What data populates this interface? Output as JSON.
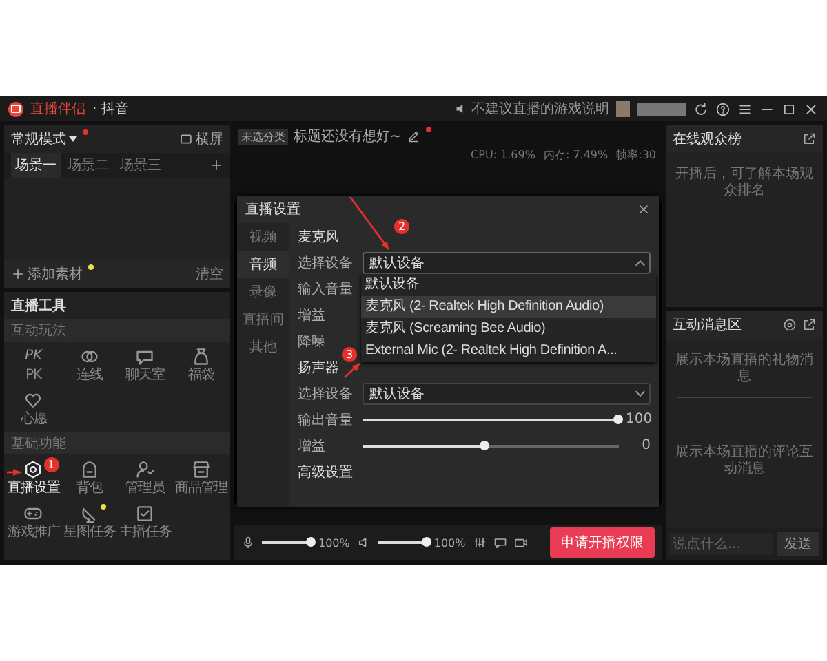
{
  "window": {
    "app_name": "直播伴侣",
    "platform": "· 抖音",
    "notice": "不建议直播的游戏说明"
  },
  "left_panel": {
    "mode": {
      "label": "常规模式",
      "new": true
    },
    "orientation": "横屏",
    "scenes": [
      {
        "label": "场景一",
        "selected": true
      },
      {
        "label": "场景二",
        "selected": false
      },
      {
        "label": "场景三",
        "selected": false
      }
    ],
    "add_material": {
      "label": "添加素材",
      "new": true
    },
    "clear": "清空",
    "tools_title": "直播工具",
    "tool_groups": [
      {
        "label": "互动玩法",
        "tools": [
          {
            "kind": "text",
            "glyph": "PK",
            "label": "PK",
            "highlighted": false,
            "new": false
          },
          {
            "kind": "link",
            "label": "连线",
            "highlighted": false,
            "new": false
          },
          {
            "kind": "chat",
            "label": "聊天室",
            "highlighted": false,
            "new": false
          },
          {
            "kind": "bag",
            "label": "福袋",
            "highlighted": false,
            "new": false
          },
          {
            "kind": "wish",
            "label": "心愿",
            "highlighted": false,
            "new": false
          }
        ]
      },
      {
        "label": "基础功能",
        "tools": [
          {
            "kind": "settings",
            "label": "直播设置",
            "highlighted": true,
            "new": false
          },
          {
            "kind": "backpack",
            "label": "背包",
            "highlighted": false,
            "new": false
          },
          {
            "kind": "admin",
            "label": "管理员",
            "highlighted": false,
            "new": false
          },
          {
            "kind": "shop",
            "label": "商品管理",
            "highlighted": false,
            "new": false
          },
          {
            "kind": "gamepad",
            "label": "游戏推广",
            "highlighted": false,
            "new": false
          },
          {
            "kind": "flag",
            "label": "星图任务",
            "highlighted": false,
            "new": true
          },
          {
            "kind": "task",
            "label": "主播任务",
            "highlighted": false,
            "new": false
          }
        ]
      }
    ]
  },
  "center": {
    "category": "未选分类",
    "title": {
      "label": "标题还没有想好~",
      "new": true
    },
    "stats": [
      "CPU: 1.69%",
      "内存: 7.49%",
      "帧率:30"
    ],
    "volume_controls": [
      {
        "kind": "mic",
        "level": 1,
        "reading": "100%"
      },
      {
        "kind": "speaker",
        "level": 1,
        "reading": "100%"
      }
    ],
    "start_button": "申请开播权限"
  },
  "dialog": {
    "title": "直播设置",
    "nav": [
      {
        "label": "视频",
        "selected": false
      },
      {
        "label": "音频",
        "selected": true
      },
      {
        "label": "录像",
        "selected": false
      },
      {
        "label": "直播间",
        "selected": false
      },
      {
        "label": "其他",
        "selected": false
      }
    ],
    "rows": [
      {
        "kind": "heading",
        "label": "麦克风"
      },
      {
        "kind": "select",
        "label": "选择设备",
        "value": "默认设备",
        "expanded": true,
        "options": [
          {
            "label": "默认设备",
            "highlighted": false
          },
          {
            "label": "麦克风 (2- Realtek High Definition Audio)",
            "highlighted": true
          },
          {
            "label": "麦克风 (Screaming Bee Audio)",
            "highlighted": false
          },
          {
            "label": "External Mic (2- Realtek High Definition A...",
            "highlighted": false
          }
        ]
      },
      {
        "kind": "label",
        "label": "输入音量"
      },
      {
        "kind": "label",
        "label": "增益"
      },
      {
        "kind": "label",
        "label": "降噪"
      },
      {
        "kind": "heading",
        "label": "扬声器"
      },
      {
        "kind": "select",
        "label": "选择设备",
        "value": "默认设备",
        "expanded": false
      },
      {
        "kind": "slider",
        "label": "输出音量",
        "level": 1,
        "reading": "100"
      },
      {
        "kind": "slider",
        "label": "增益",
        "level": 0.48,
        "reading": "0"
      },
      {
        "kind": "heading",
        "label": "高级设置"
      }
    ]
  },
  "right_panel": {
    "audience": {
      "title": "在线观众榜",
      "empty_text": "开播后，可了解本场观众排名"
    },
    "messages": {
      "title": "互动消息区",
      "gift_text": "展示本场直播的礼物消息",
      "comment_text": "展示本场直播的评论互动消息",
      "input_placeholder": "说点什么...",
      "send": "发送"
    }
  },
  "annotations": [
    {
      "label": "1"
    },
    {
      "label": "2"
    },
    {
      "label": "3"
    }
  ]
}
